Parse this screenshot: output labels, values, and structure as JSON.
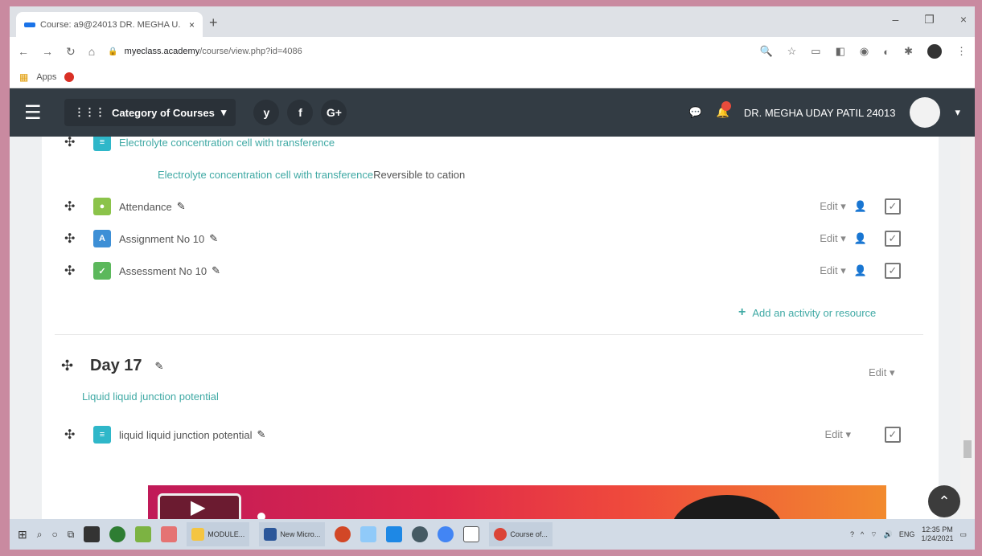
{
  "browser": {
    "tab_title": "Course: a9@24013 DR. MEGHA U.",
    "tab_close": "×",
    "new_tab": "+",
    "url_host": "myeclass.academy",
    "url_path": "/course/view.php?id=4086",
    "bookmarks_apps": "Apps",
    "window_controls": [
      "–",
      "❐",
      "×"
    ]
  },
  "navbar": {
    "category_label": "Category of Courses",
    "social": [
      "y",
      "f",
      "G+"
    ],
    "user_name": "DR. MEGHA UDAY PATIL 24013"
  },
  "section_top": {
    "link_text": "Electrolyte concentration cell with transference",
    "restriction_text": "Reversible to cation"
  },
  "activities": [
    {
      "name": "Attendance",
      "edit": "Edit",
      "icon": "attendance-icon",
      "color": "#8bc34a"
    },
    {
      "name": "Assignment No 10",
      "edit": "Edit",
      "icon": "assignment-icon",
      "color": "#3d8fd6"
    },
    {
      "name": "Assessment No 10",
      "edit": "Edit",
      "icon": "assessment-icon",
      "color": "#5cb85c"
    }
  ],
  "add_activity": "Add an activity or resource",
  "day_section": {
    "title": "Day 17",
    "edit": "Edit",
    "summary": "Liquid liquid junction potential",
    "activity": {
      "name": "liquid liquid junction potential",
      "edit": "Edit",
      "icon": "page-icon",
      "color": "#2fb7c9"
    }
  },
  "taskbar": {
    "apps": [
      "MODULE...",
      "New Micro...",
      "Course of..."
    ],
    "lang": "ENG",
    "time": "12:35 PM",
    "date": "1/24/2021"
  }
}
